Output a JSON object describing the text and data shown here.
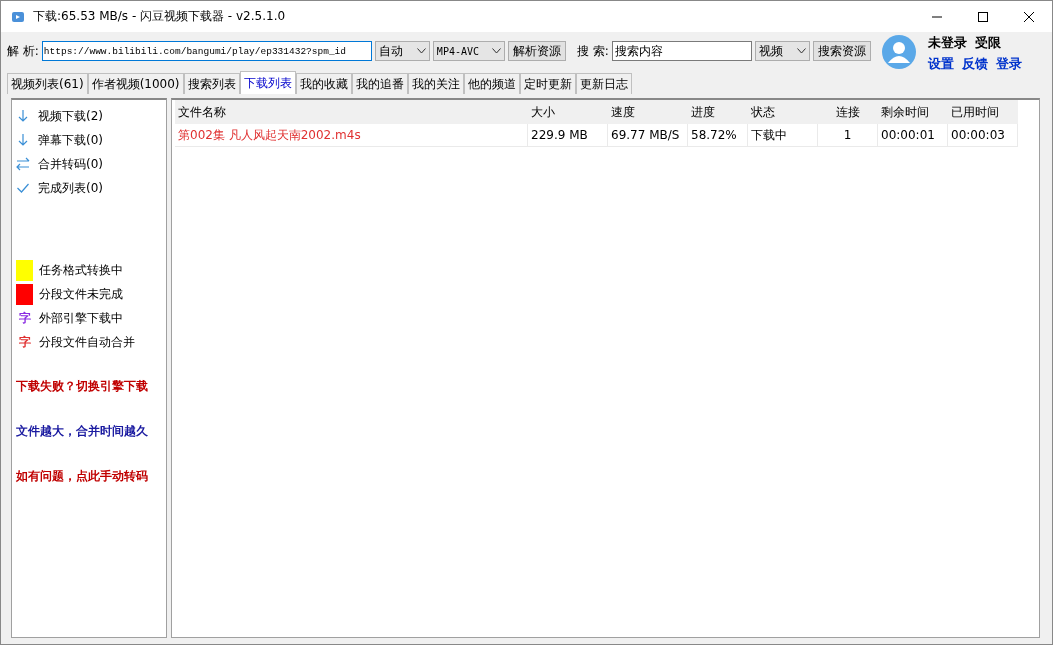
{
  "window": {
    "title": "下载:65.53 MB/s - 闪豆视频下载器 - v2.5.1.0"
  },
  "toolbar": {
    "parse_label": "解 析:",
    "url": "https://www.bilibili.com/bangumi/play/ep331432?spm_id",
    "quality": "自动",
    "format": "MP4-AVC",
    "parse_button": "解析资源",
    "search_label": "搜 索:",
    "search_value": "搜索内容",
    "search_type": "视频",
    "search_button": "搜索资源"
  },
  "account": {
    "status": "未登录",
    "limit": "受限",
    "links": [
      "设置",
      "反馈",
      "登录"
    ]
  },
  "tabs": [
    {
      "label": "视频列表(61)",
      "selected": false
    },
    {
      "label": "作者视频(1000)",
      "selected": false
    },
    {
      "label": "搜索列表",
      "selected": false
    },
    {
      "label": "下载列表",
      "selected": true
    },
    {
      "label": "我的收藏",
      "selected": false
    },
    {
      "label": "我的追番",
      "selected": false
    },
    {
      "label": "我的关注",
      "selected": false
    },
    {
      "label": "他的频道",
      "selected": false
    },
    {
      "label": "定时更新",
      "selected": false
    },
    {
      "label": "更新日志",
      "selected": false
    }
  ],
  "sidebar": {
    "items": [
      {
        "kind": "download",
        "label": "视频下载(2)"
      },
      {
        "kind": "download",
        "label": "弹幕下载(0)"
      },
      {
        "kind": "merge",
        "label": "合并转码(0)"
      },
      {
        "kind": "done",
        "label": "完成列表(0)"
      }
    ],
    "legend": [
      {
        "kind": "swatch",
        "color": "#ffff00",
        "label": "任务格式转换中"
      },
      {
        "kind": "swatch",
        "color": "#ff0000",
        "label": "分段文件未完成"
      },
      {
        "kind": "glyph",
        "color": "#8a2be2",
        "glyph": "字",
        "label": "外部引擎下载中"
      },
      {
        "kind": "glyph",
        "color": "#e03030",
        "glyph": "字",
        "label": "分段文件自动合并"
      }
    ],
    "notes": [
      {
        "text": "下载失败？切换引擎下载",
        "color": "#c00000"
      },
      {
        "text": "文件越大，合并时间越久",
        "color": "#1a1aa0"
      },
      {
        "text": "如有问题，点此手动转码",
        "color": "#c00000"
      }
    ]
  },
  "table": {
    "columns": [
      "文件名称",
      "大小",
      "速度",
      "进度",
      "状态",
      "连接",
      "剩余时间",
      "已用时间"
    ],
    "rows": [
      {
        "color": "#e03030",
        "cells": [
          "第002集 凡人风起天南2002.m4s",
          "229.9 MB",
          "69.77 MB/S",
          "58.72%",
          "下载中",
          "1",
          "00:00:01",
          "00:00:03"
        ]
      }
    ]
  }
}
